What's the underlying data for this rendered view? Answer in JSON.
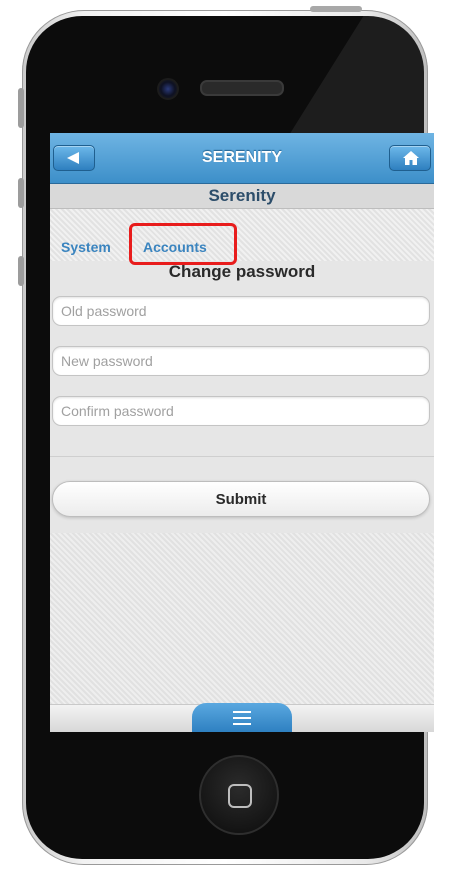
{
  "app": {
    "title": "SERENITY",
    "subtitle": "Serenity"
  },
  "header": {
    "back_icon": "back-arrow-icon",
    "home_icon": "home-icon"
  },
  "tabs": [
    {
      "label": "System"
    },
    {
      "label": "Accounts"
    }
  ],
  "section": {
    "title": "Change password"
  },
  "form": {
    "old_password_placeholder": "Old password",
    "new_password_placeholder": "New password",
    "confirm_password_placeholder": "Confirm password",
    "submit_label": "Submit"
  },
  "footer": {
    "menu_icon": "menu-icon"
  },
  "colors": {
    "header_blue": "#3d8fc9",
    "tab_blue": "#3a84bf",
    "highlight_red": "#e81c1c"
  }
}
